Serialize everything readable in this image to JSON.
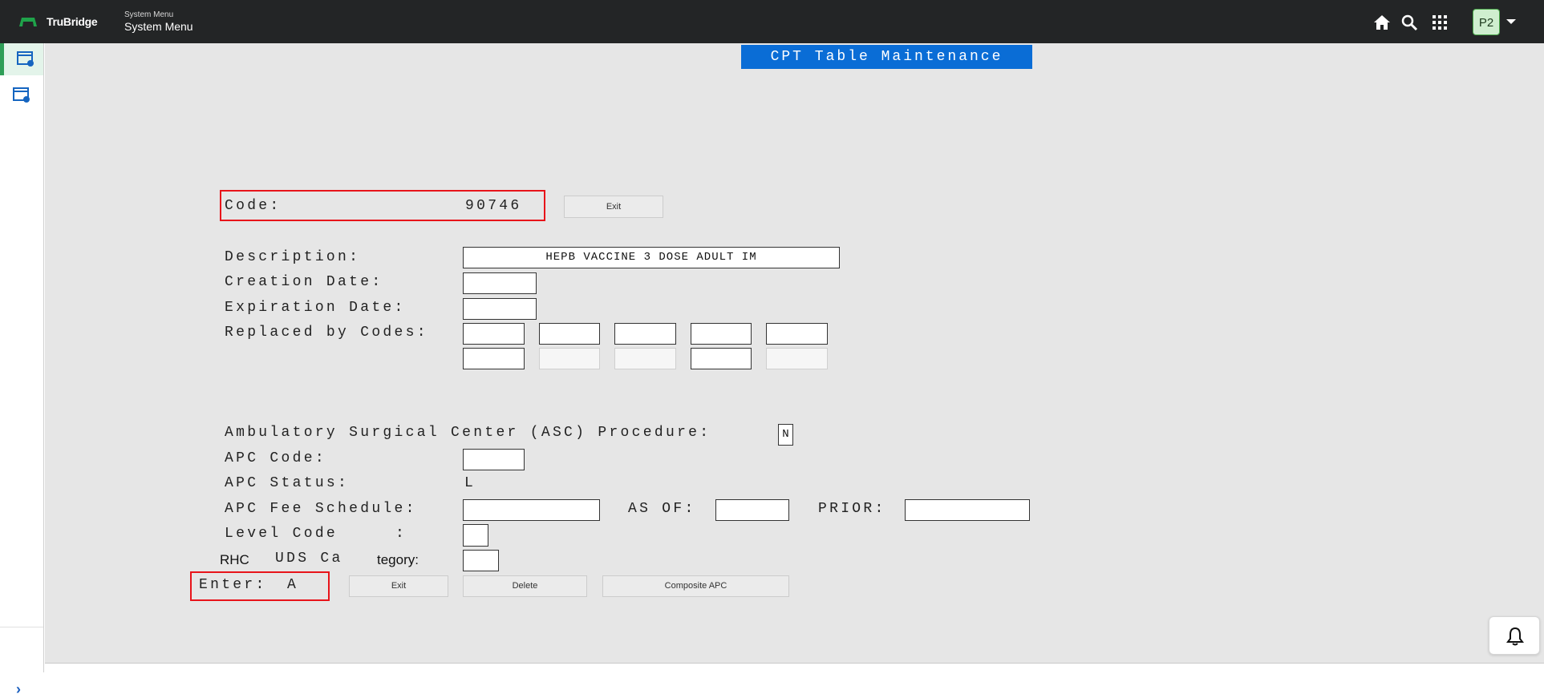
{
  "header": {
    "brand": "TruBridge",
    "menu_small": "System Menu",
    "menu_big": "System Menu",
    "user_initials": "P2",
    "icons": [
      "home-icon",
      "search-icon",
      "apps-grid-icon",
      "chevron-down-icon"
    ],
    "colors": {
      "topbar": "#232526",
      "avatar_bg": "#cfeecf"
    }
  },
  "sidebar": {
    "items": [
      {
        "icon": "window-settings-icon",
        "active": true
      },
      {
        "icon": "window-settings-icon",
        "active": false
      }
    ],
    "expand_icon": "chevron-right-icon",
    "expand_glyph": "›"
  },
  "screen": {
    "title": "CPT Table Maintenance",
    "code": {
      "label": "Code:",
      "value": "90746"
    },
    "exit_top": "Exit",
    "description": {
      "label": "Description:",
      "value": "HEPB VACCINE 3 DOSE ADULT IM"
    },
    "creation_date": {
      "label": "Creation Date:",
      "value": ""
    },
    "expiration_date": {
      "label": "Expiration Date:",
      "value": ""
    },
    "replaced_by": {
      "label": "Replaced by Codes:",
      "values": [
        "",
        "",
        "",
        "",
        "",
        "",
        "",
        "",
        "",
        ""
      ]
    },
    "asc": {
      "label": "Ambulatory Surgical Center (ASC) Procedure:",
      "value": "N"
    },
    "apc_code": {
      "label": "APC Code:",
      "value": ""
    },
    "apc_status": {
      "label": "APC Status:",
      "value": "L"
    },
    "apc_fee": {
      "label": "APC Fee Schedule:",
      "value": "",
      "as_of_label": "AS OF:",
      "as_of": "",
      "prior_label": "PRIOR:",
      "prior": ""
    },
    "level_code": {
      "label": "Level Code",
      "colon": ":",
      "value": ""
    },
    "rhc": {
      "part1": "RHC",
      "part2": "UDS Ca",
      "part3": "tegory:",
      "value": ""
    },
    "enter": {
      "label": "Enter:",
      "value": "A"
    },
    "buttons": {
      "exit": "Exit",
      "delete": "Delete",
      "composite": "Composite APC"
    }
  },
  "notification_icon": "bell-icon"
}
